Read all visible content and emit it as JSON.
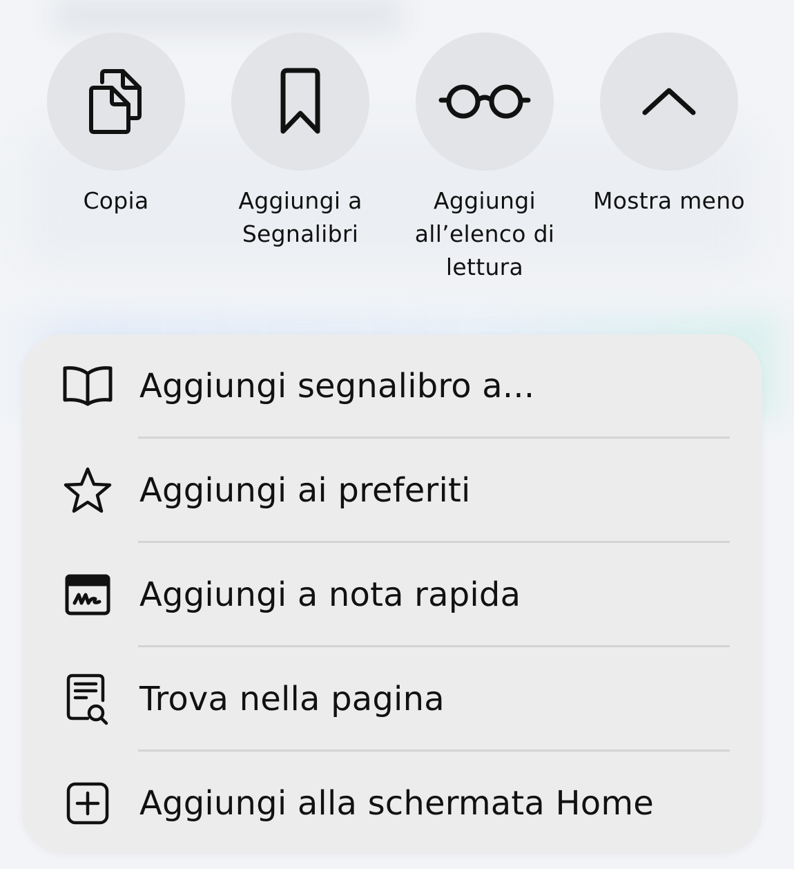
{
  "actions": [
    {
      "id": "copy",
      "label": "Copia",
      "icon": "copy-icon"
    },
    {
      "id": "bookmark",
      "label": "Aggiungi a\nSegnalibri",
      "icon": "bookmark-icon"
    },
    {
      "id": "reading",
      "label": "Aggiungi\nall’elenco di\nlettura",
      "icon": "glasses-icon"
    },
    {
      "id": "less",
      "label": "Mostra meno",
      "icon": "chevron-up-icon"
    }
  ],
  "menu": {
    "items": [
      {
        "label": "Aggiungi segnalibro a...",
        "icon": "book-icon"
      },
      {
        "label": "Aggiungi ai preferiti",
        "icon": "star-icon"
      },
      {
        "label": "Aggiungi a nota rapida",
        "icon": "quick-note-icon"
      },
      {
        "label": "Trova nella pagina",
        "icon": "find-in-page-icon"
      },
      {
        "label": "Aggiungi alla schermata Home",
        "icon": "add-square-icon"
      }
    ]
  },
  "colors": {
    "background": "#f2f4f7",
    "circle": "#e2e4e7",
    "panel": "#ececed",
    "separator": "#d4d4d6",
    "text": "#111111"
  }
}
